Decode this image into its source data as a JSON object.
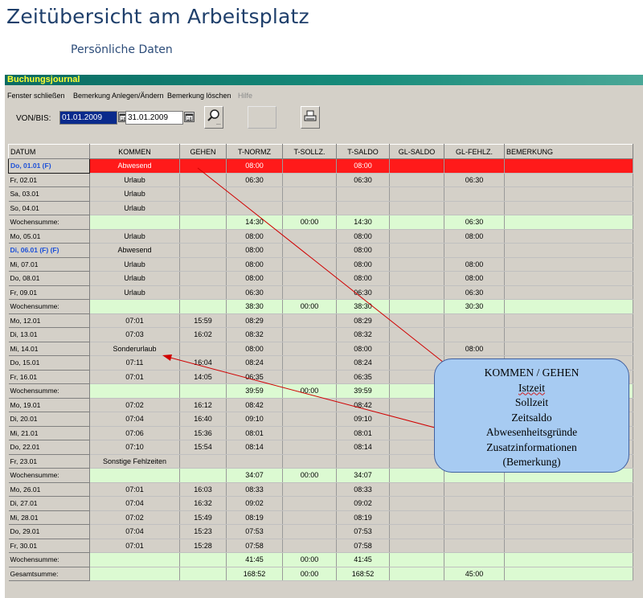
{
  "page": {
    "title": "Zeitübersicht am Arbeitsplatz",
    "subtitle": "Persönliche Daten"
  },
  "window": {
    "title": "Buchungsjournal",
    "menu": [
      "Fenster schließen",
      "Bemerkung Anlegen/Ändern",
      "Bemerkung löschen",
      "Hilfe"
    ],
    "range_label": "VON/BIS:",
    "date_from": "01.01.2009",
    "date_to": "31.01.2009",
    "icons": {
      "calendar": "calendar-icon",
      "search": "magnifier-icon",
      "print": "printer-icon"
    }
  },
  "table": {
    "columns": [
      "DATUM",
      "KOMMEN",
      "GEHEN",
      "T-NORMZ",
      "T-SOLLZ.",
      "T-SALDO",
      "GL-SALDO",
      "GL-FEHLZ.",
      "BEMERKUNG"
    ],
    "rows": [
      {
        "type": "first",
        "cells": [
          "Do, 01.01 (F)",
          "Abwesend",
          "",
          "08:00",
          "",
          "08:00",
          "",
          "",
          ""
        ]
      },
      {
        "type": "day",
        "cells": [
          "Fr, 02.01",
          "Urlaub",
          "",
          "06:30",
          "",
          "06:30",
          "",
          "06:30",
          ""
        ]
      },
      {
        "type": "day",
        "cells": [
          "Sa, 03.01",
          "Urlaub",
          "",
          "",
          "",
          "",
          "",
          "",
          ""
        ]
      },
      {
        "type": "day",
        "cells": [
          "So, 04.01",
          "Urlaub",
          "",
          "",
          "",
          "",
          "",
          "",
          ""
        ]
      },
      {
        "type": "week",
        "cells": [
          "Wochensumme:",
          "",
          "",
          "14:30",
          "00:00",
          "14:30",
          "",
          "06:30",
          ""
        ]
      },
      {
        "type": "day",
        "cells": [
          "Mo, 05.01",
          "Urlaub",
          "",
          "08:00",
          "",
          "08:00",
          "",
          "08:00",
          ""
        ]
      },
      {
        "type": "holiday",
        "cells": [
          "Di, 06.01 (F) (F)",
          "Abwesend",
          "",
          "08:00",
          "",
          "08:00",
          "",
          "",
          ""
        ]
      },
      {
        "type": "day",
        "cells": [
          "Mi, 07.01",
          "Urlaub",
          "",
          "08:00",
          "",
          "08:00",
          "",
          "08:00",
          ""
        ]
      },
      {
        "type": "day",
        "cells": [
          "Do, 08.01",
          "Urlaub",
          "",
          "08:00",
          "",
          "08:00",
          "",
          "08:00",
          ""
        ]
      },
      {
        "type": "day",
        "cells": [
          "Fr, 09.01",
          "Urlaub",
          "",
          "06:30",
          "",
          "06:30",
          "",
          "06:30",
          ""
        ]
      },
      {
        "type": "week",
        "cells": [
          "Wochensumme:",
          "",
          "",
          "38:30",
          "00:00",
          "38:30",
          "",
          "30:30",
          ""
        ]
      },
      {
        "type": "day",
        "cells": [
          "Mo, 12.01",
          "07:01",
          "15:59",
          "08:29",
          "",
          "08:29",
          "",
          "",
          ""
        ]
      },
      {
        "type": "day",
        "cells": [
          "Di, 13.01",
          "07:03",
          "16:02",
          "08:32",
          "",
          "08:32",
          "",
          "",
          ""
        ]
      },
      {
        "type": "day",
        "cells": [
          "Mi, 14.01",
          "Sonderurlaub",
          "",
          "08:00",
          "",
          "08:00",
          "",
          "08:00",
          ""
        ]
      },
      {
        "type": "day",
        "cells": [
          "Do, 15.01",
          "07:11",
          "16:04",
          "08:24",
          "",
          "08:24",
          "",
          "",
          ""
        ]
      },
      {
        "type": "day",
        "cells": [
          "Fr, 16.01",
          "07:01",
          "14:05",
          "06:35",
          "",
          "06:35",
          "",
          "",
          ""
        ]
      },
      {
        "type": "week",
        "cells": [
          "Wochensumme:",
          "",
          "",
          "39:59",
          "00:00",
          "39:59",
          "",
          "",
          ""
        ]
      },
      {
        "type": "day",
        "cells": [
          "Mo, 19.01",
          "07:02",
          "16:12",
          "08:42",
          "",
          "08:42",
          "",
          "",
          ""
        ]
      },
      {
        "type": "day",
        "cells": [
          "Di, 20.01",
          "07:04",
          "16:40",
          "09:10",
          "",
          "09:10",
          "",
          "",
          ""
        ]
      },
      {
        "type": "day",
        "cells": [
          "Mi, 21.01",
          "07:06",
          "15:36",
          "08:01",
          "",
          "08:01",
          "",
          "",
          ""
        ]
      },
      {
        "type": "day",
        "cells": [
          "Do, 22.01",
          "07:10",
          "15:54",
          "08:14",
          "",
          "08:14",
          "",
          "",
          ""
        ]
      },
      {
        "type": "day",
        "cells": [
          "Fr, 23.01",
          "Sonstige Fehlzeiten",
          "",
          "",
          "",
          "",
          "",
          "",
          ""
        ]
      },
      {
        "type": "week",
        "cells": [
          "Wochensumme:",
          "",
          "",
          "34:07",
          "00:00",
          "34:07",
          "",
          "",
          ""
        ]
      },
      {
        "type": "day",
        "cells": [
          "Mo, 26.01",
          "07:01",
          "16:03",
          "08:33",
          "",
          "08:33",
          "",
          "",
          ""
        ]
      },
      {
        "type": "day",
        "cells": [
          "Di, 27.01",
          "07:04",
          "16:32",
          "09:02",
          "",
          "09:02",
          "",
          "",
          ""
        ]
      },
      {
        "type": "day",
        "cells": [
          "Mi, 28.01",
          "07:02",
          "15:49",
          "08:19",
          "",
          "08:19",
          "",
          "",
          ""
        ]
      },
      {
        "type": "day",
        "cells": [
          "Do, 29.01",
          "07:04",
          "15:23",
          "07:53",
          "",
          "07:53",
          "",
          "",
          ""
        ]
      },
      {
        "type": "day",
        "cells": [
          "Fr, 30.01",
          "07:01",
          "15:28",
          "07:58",
          "",
          "07:58",
          "",
          "",
          ""
        ]
      },
      {
        "type": "week",
        "cells": [
          "Wochensumme:",
          "",
          "",
          "41:45",
          "00:00",
          "41:45",
          "",
          "",
          ""
        ]
      },
      {
        "type": "total",
        "cells": [
          "Gesamtsumme:",
          "",
          "",
          "168:52",
          "00:00",
          "168:52",
          "",
          "45:00",
          ""
        ]
      }
    ]
  },
  "callout": {
    "lines": [
      "KOMMEN / GEHEN",
      "Istzeit",
      "Sollzeit",
      "Zeitsaldo",
      "Abwesenheitsgründe",
      "Zusatzinformationen",
      "(Bemerkung)"
    ],
    "colors": {
      "fill": "#a7cbf2",
      "arrow": "#d00000"
    }
  },
  "colors": {
    "title": "#1f3f6b",
    "titlebar": "#0a6b63",
    "titlebar_text": "#ffff33",
    "week_row": "#dcfad2",
    "first_row": "#ff1a1a",
    "holiday_text": "#1c50d8"
  }
}
